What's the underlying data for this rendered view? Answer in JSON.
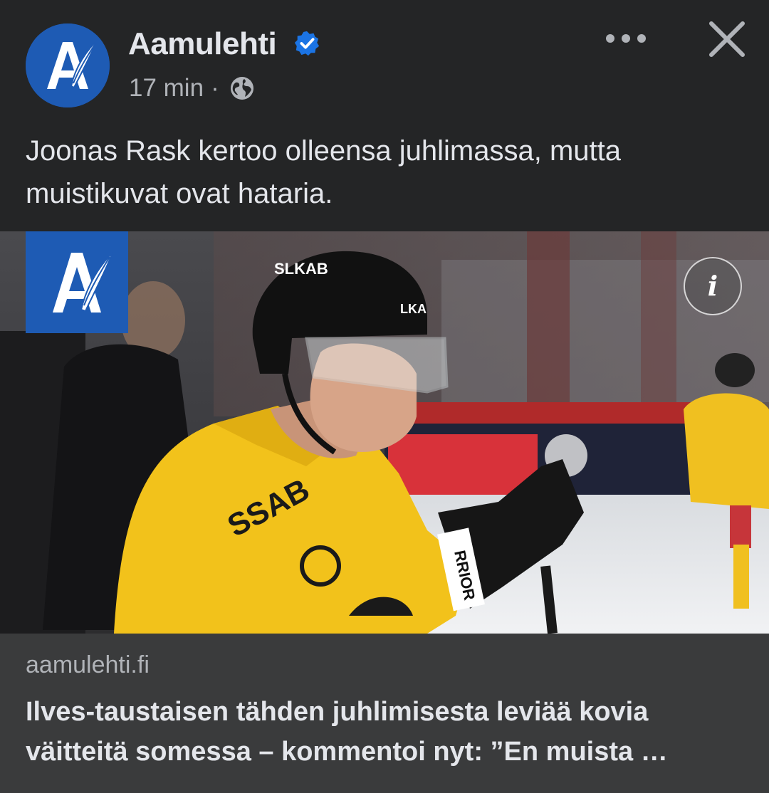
{
  "post": {
    "page_name": "Aamulehti",
    "verified": true,
    "time": "17 min",
    "separator": "·",
    "audience_icon": "globe-icon",
    "caption": "Joonas Rask kertoo olleensa juhlimassa, mutta muistikuvat ovat hataria.",
    "avatar_letter": "A"
  },
  "image": {
    "description_icon": "info-icon",
    "info_label": "i",
    "brand_color": "#1e5bb4"
  },
  "link": {
    "domain": "aamulehti.fi",
    "headline": "Ilves-taustaisen tähden juhlimisesta leviää kovia väitteitä somessa – kommentoi nyt: ”En muista …"
  },
  "colors": {
    "background": "#242526",
    "link_background": "#3a3b3c",
    "primary_text": "#e4e6eb",
    "secondary_text": "#b0b3b8",
    "verified_blue": "#1b74e4",
    "jersey_yellow": "#f2c21b"
  }
}
